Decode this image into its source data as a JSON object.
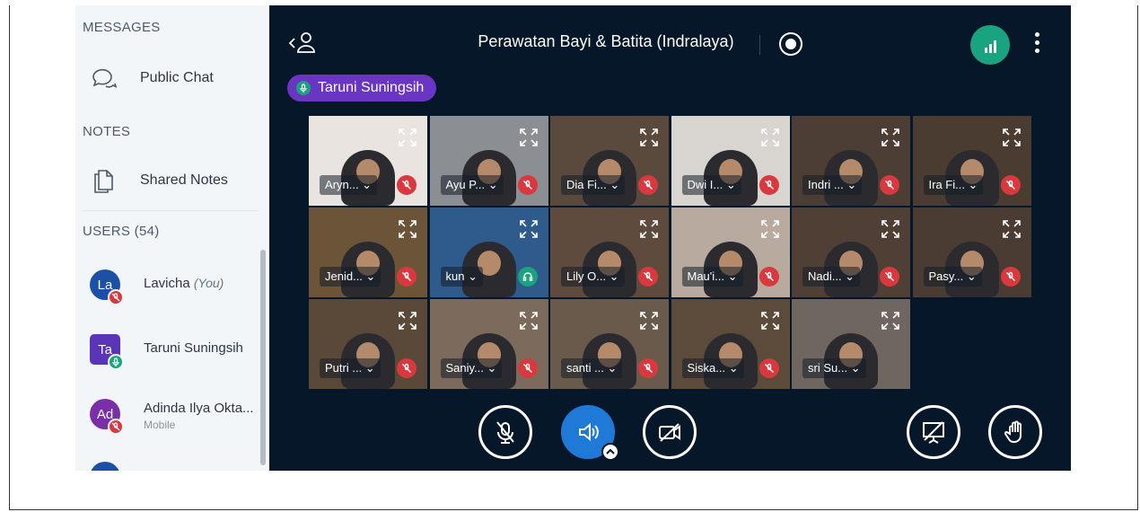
{
  "sidebar": {
    "messages_heading": "MESSAGES",
    "public_chat_label": "Public Chat",
    "notes_heading": "NOTES",
    "shared_notes_label": "Shared Notes",
    "users_heading": "USERS (54)",
    "users": [
      {
        "initials": "La",
        "name": "Lavicha",
        "you_tag": "(You)",
        "sub": "",
        "color": "#1c4fa6",
        "status": "muted"
      },
      {
        "initials": "Ta",
        "name": "Taruni Suningsih",
        "you_tag": "",
        "sub": "",
        "color": "#5b35b8",
        "status": "talking"
      },
      {
        "initials": "Ad",
        "name": "Adinda Ilya Okta...",
        "you_tag": "",
        "sub": "Mobile",
        "color": "#7a2fa8",
        "status": "muted"
      }
    ]
  },
  "meeting": {
    "title": "Perawatan Bayi & Batita (Indralaya)",
    "talker_name": "Taruni Suningsih",
    "accent_color": "#1aa37f",
    "talker_color": "#6b35c4",
    "muted_color": "#d9393e",
    "audio_color": "#1f79d6"
  },
  "videos": [
    {
      "name": "Aryn... ⌄",
      "status": "muted",
      "bg": "#e9e4e0"
    },
    {
      "name": "Ayu P... ⌄",
      "status": "muted",
      "bg": "#8b8f94"
    },
    {
      "name": "Dia Fi... ⌄",
      "status": "muted",
      "bg": "#5a4a3e"
    },
    {
      "name": "Dwi I... ⌄",
      "status": "muted",
      "bg": "#d8d4cf"
    },
    {
      "name": "Indri ... ⌄",
      "status": "muted",
      "bg": "#4c3e34"
    },
    {
      "name": "Ira Fi... ⌄",
      "status": "muted",
      "bg": "#4a3c30"
    },
    {
      "name": "Jenid... ⌄",
      "status": "muted",
      "bg": "#6b5438"
    },
    {
      "name": "kun ⌄",
      "status": "listen",
      "bg": "#2f5a8c"
    },
    {
      "name": "Lily O... ⌄",
      "status": "muted",
      "bg": "#5e4b3d"
    },
    {
      "name": "Mau'i... ⌄",
      "status": "muted",
      "bg": "#b9aaa0"
    },
    {
      "name": "Nadi... ⌄",
      "status": "muted",
      "bg": "#4f3f34"
    },
    {
      "name": "Pasy... ⌄",
      "status": "muted",
      "bg": "#4a3c32"
    },
    {
      "name": "Putri ... ⌄",
      "status": "muted",
      "bg": "#5a4838"
    },
    {
      "name": "Saniy... ⌄",
      "status": "muted",
      "bg": "#7c6b5c"
    },
    {
      "name": "santi ... ⌄",
      "status": "muted",
      "bg": "#6a5a4c"
    },
    {
      "name": "Siska... ⌄",
      "status": "muted",
      "bg": "#5c4a3a"
    },
    {
      "name": "sri Su... ⌄",
      "status": "none",
      "bg": "#6f6660"
    }
  ]
}
